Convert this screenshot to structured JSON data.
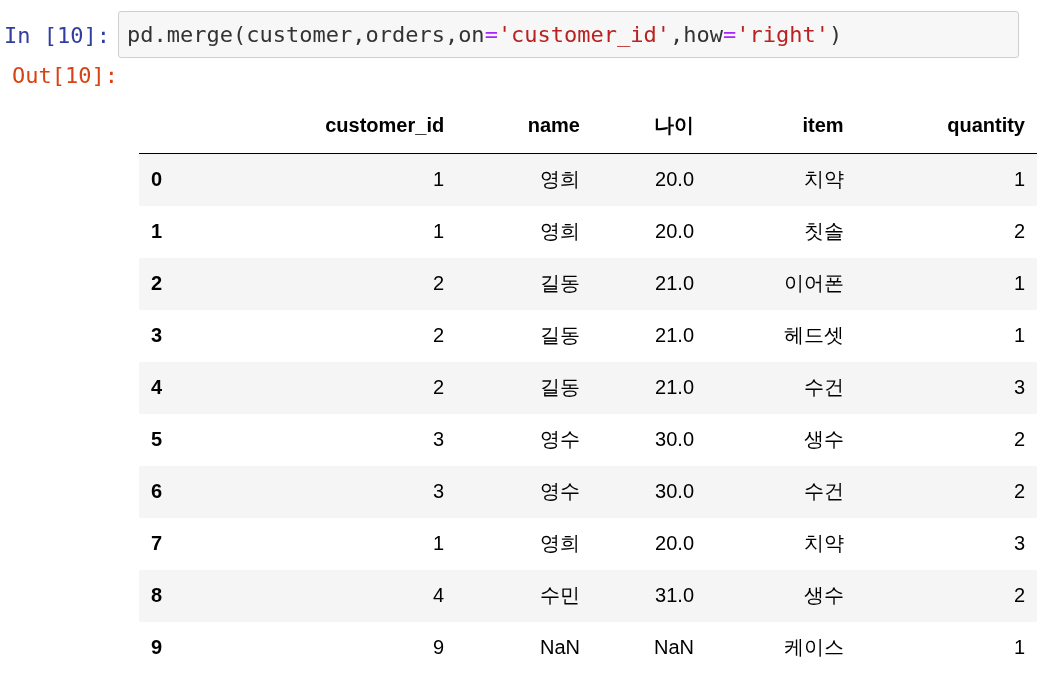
{
  "input_prompt": "In [10]:",
  "code_tokens": [
    {
      "kind": "plain",
      "text": "pd.merge(customer,orders,on"
    },
    {
      "kind": "operator",
      "text": "="
    },
    {
      "kind": "string",
      "text": "'customer_id'"
    },
    {
      "kind": "plain",
      "text": ",how"
    },
    {
      "kind": "operator",
      "text": "="
    },
    {
      "kind": "string",
      "text": "'right'"
    },
    {
      "kind": "plain",
      "text": ")"
    }
  ],
  "output_prompt": "Out[10]:",
  "table": {
    "columns": [
      "",
      "customer_id",
      "name",
      "나이",
      "item",
      "quantity"
    ],
    "rows": [
      [
        "0",
        "1",
        "영희",
        "20.0",
        "치약",
        "1"
      ],
      [
        "1",
        "1",
        "영희",
        "20.0",
        "칫솔",
        "2"
      ],
      [
        "2",
        "2",
        "길동",
        "21.0",
        "이어폰",
        "1"
      ],
      [
        "3",
        "2",
        "길동",
        "21.0",
        "헤드셋",
        "1"
      ],
      [
        "4",
        "2",
        "길동",
        "21.0",
        "수건",
        "3"
      ],
      [
        "5",
        "3",
        "영수",
        "30.0",
        "생수",
        "2"
      ],
      [
        "6",
        "3",
        "영수",
        "30.0",
        "수건",
        "2"
      ],
      [
        "7",
        "1",
        "영희",
        "20.0",
        "치약",
        "3"
      ],
      [
        "8",
        "4",
        "수민",
        "31.0",
        "생수",
        "2"
      ],
      [
        "9",
        "9",
        "NaN",
        "NaN",
        "케이스",
        "1"
      ]
    ]
  }
}
